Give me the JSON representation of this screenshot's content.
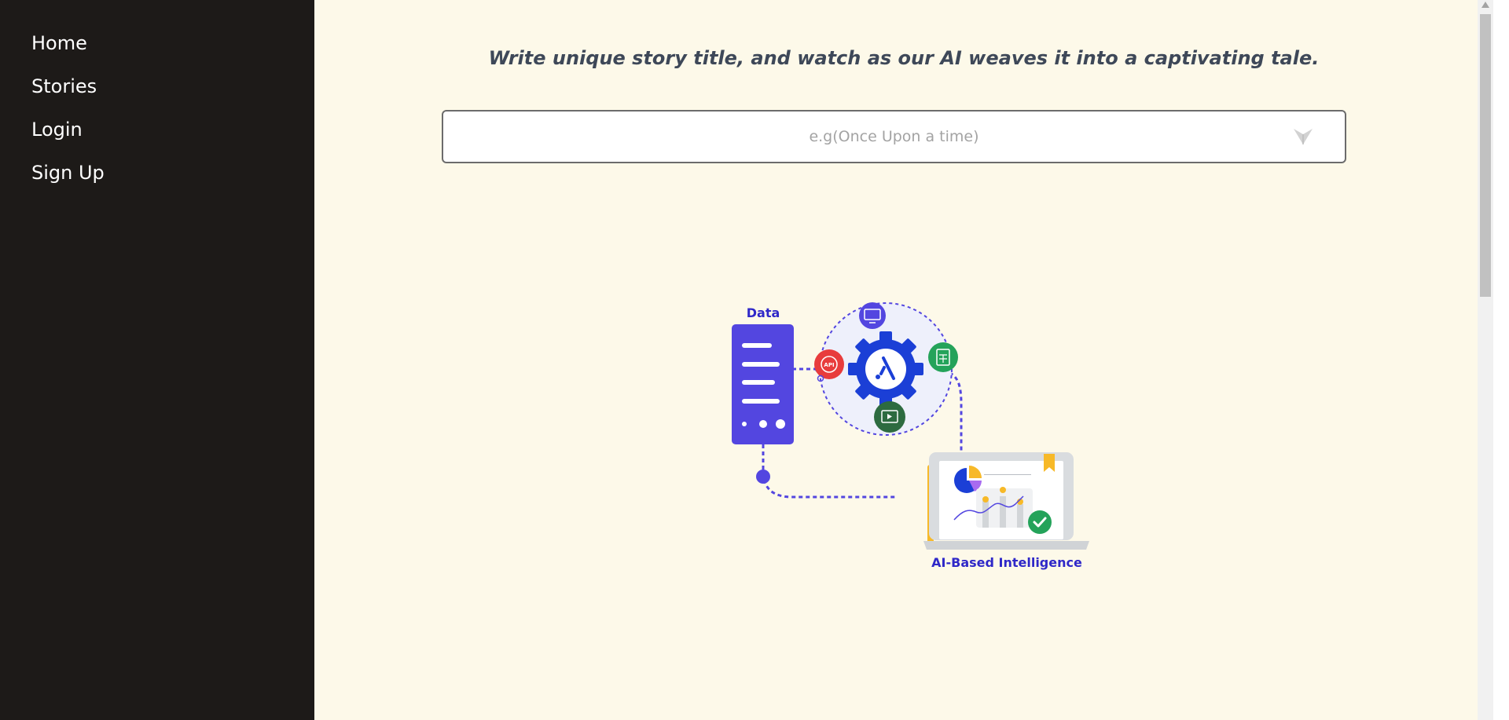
{
  "sidebar": {
    "items": [
      {
        "label": "Home"
      },
      {
        "label": "Stories"
      },
      {
        "label": "Login"
      },
      {
        "label": "Sign Up"
      }
    ]
  },
  "main": {
    "tagline": "Write unique story title, and watch as our AI weaves it into a captivating tale.",
    "story_input": {
      "value": "",
      "placeholder": "e.g(Once Upon a time)"
    },
    "illustration": {
      "data_label": "Data",
      "ai_label": "AI-Based Intelligence",
      "api_badge": "API"
    }
  },
  "colors": {
    "sidebar_bg": "#1d1a18",
    "main_bg": "#fdf9e9",
    "accent_purple": "#5346e0",
    "accent_blue": "#1b3fd6",
    "accent_red": "#e83c3c",
    "accent_green": "#24a35a",
    "accent_yellow": "#f7b928"
  }
}
